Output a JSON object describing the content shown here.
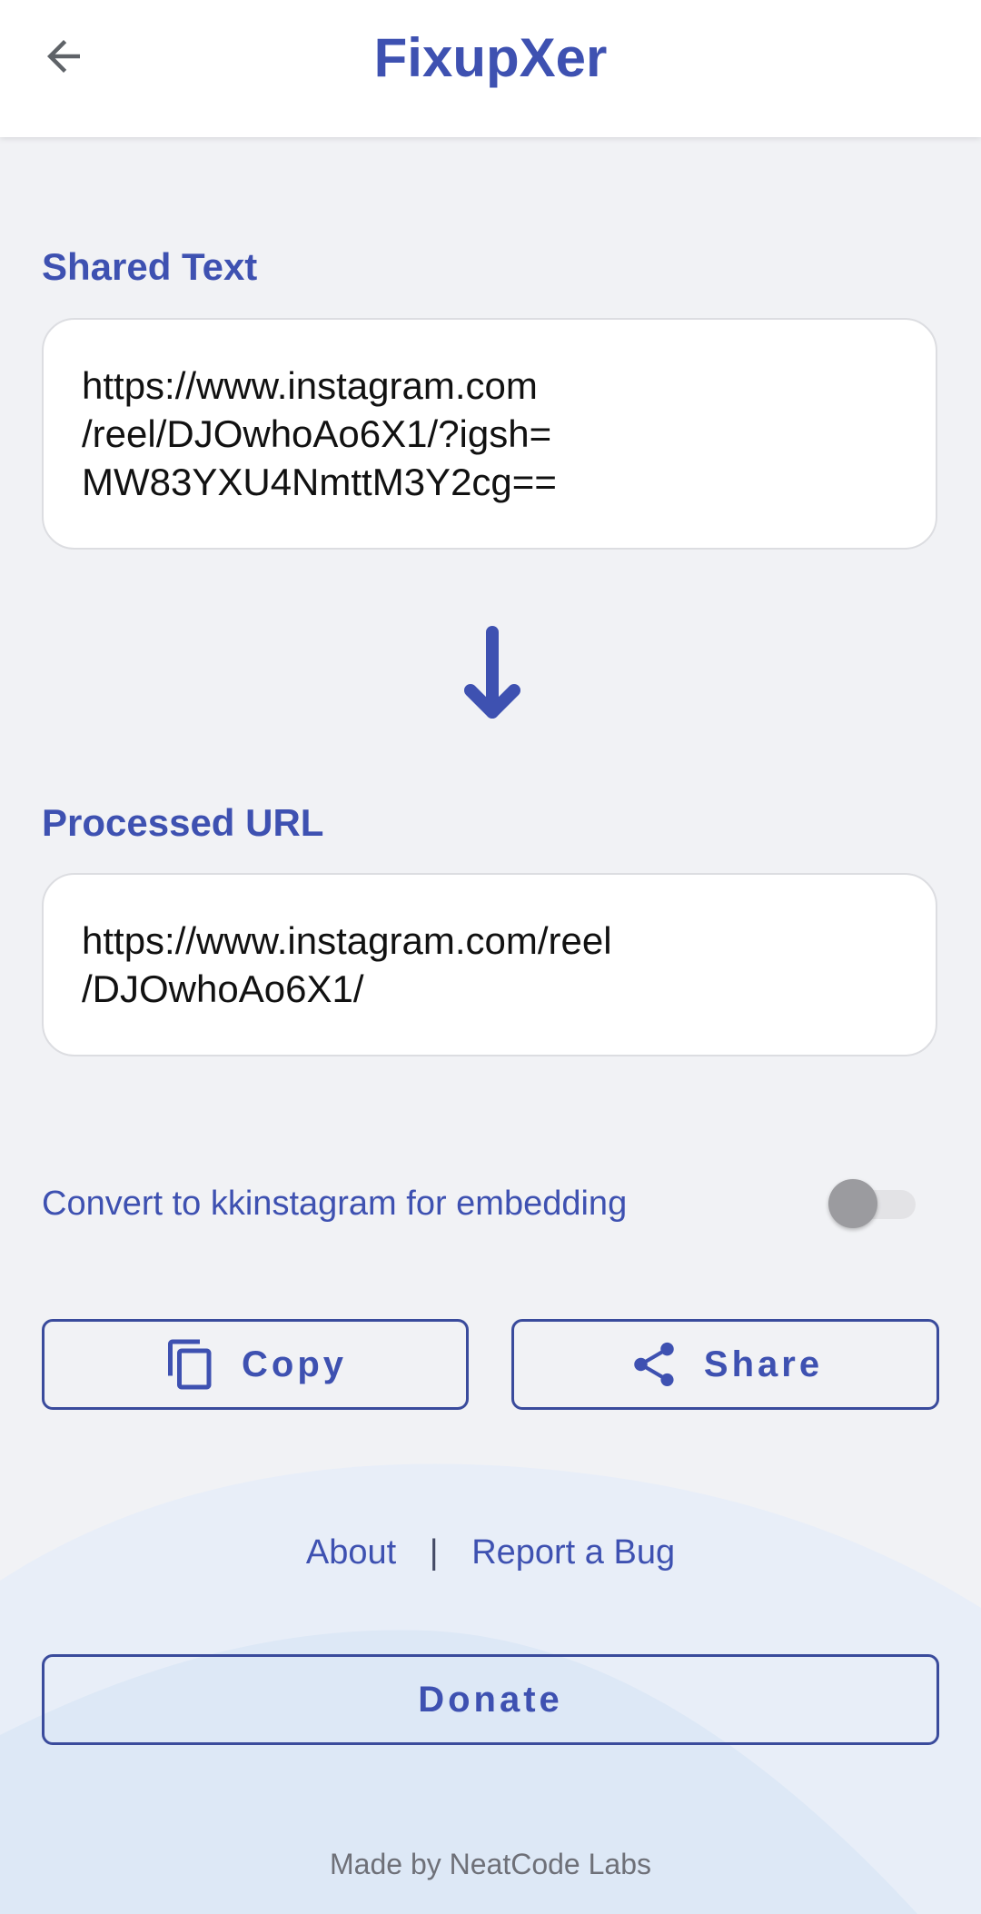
{
  "app_bar": {
    "title": "FixupXer",
    "back_icon": "arrow-back-icon"
  },
  "shared_text": {
    "label": "Shared Text",
    "value": "https://www.instagram.com\n/reel/DJOwhoAo6X1/?igsh=\nMW83YXU4NmttM3Y2cg=="
  },
  "arrow_icon": "arrow-down-icon",
  "processed_url": {
    "label": "Processed URL",
    "value": "https://www.instagram.com/reel\n/DJOwhoAo6X1/"
  },
  "toggle": {
    "label": "Convert to kkinstagram for embedding",
    "on": false
  },
  "buttons": {
    "copy_label": "Copy",
    "copy_icon": "copy-icon",
    "share_label": "Share",
    "share_icon": "share-icon",
    "donate_label": "Donate"
  },
  "footer": {
    "about": "About",
    "separator": "|",
    "report_bug": "Report a Bug",
    "made_by": "Made by NeatCode Labs"
  },
  "colors": {
    "accent": "#3e51b1",
    "background": "#f1f2f5",
    "wave_light": "#e8eef8",
    "wave_dark": "#dde8f6"
  }
}
